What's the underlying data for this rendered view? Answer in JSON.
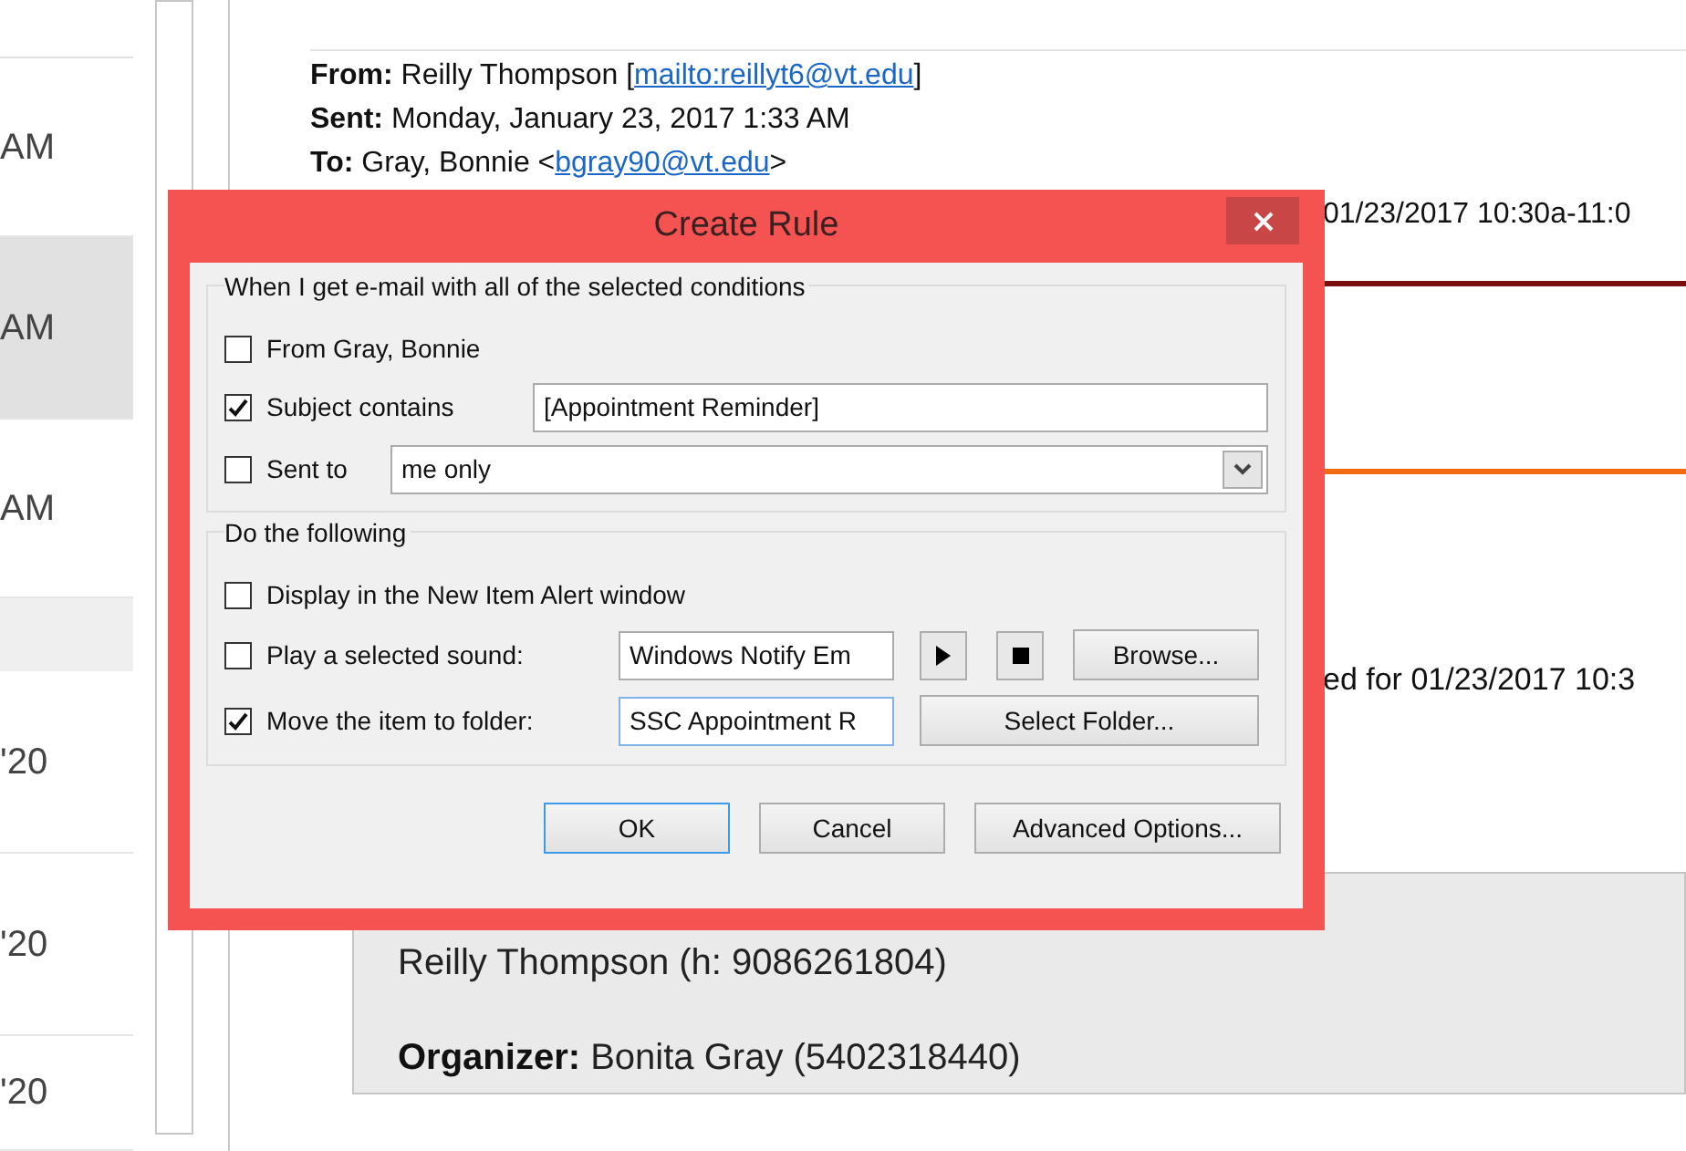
{
  "message_list": {
    "items": [
      {
        "kind": "message",
        "time": "AM",
        "selected": false
      },
      {
        "kind": "message",
        "time": "AM",
        "selected": true
      },
      {
        "kind": "message",
        "time": "AM",
        "selected": false
      },
      {
        "kind": "header"
      },
      {
        "kind": "message",
        "time": "'20",
        "selected": false
      },
      {
        "kind": "message",
        "time": "'20",
        "selected": false
      },
      {
        "kind": "message",
        "time": "'20",
        "selected": false
      }
    ]
  },
  "reading_pane": {
    "headers": [
      {
        "label": "From:",
        "text": "Reilly Thompson [",
        "link": "mailto:reillyt6@vt.edu",
        "suffix": "]"
      },
      {
        "label": "Sent:",
        "text": "Monday, January 23, 2017 1:33 AM"
      },
      {
        "label": "To:",
        "text": "Gray, Bonnie <",
        "link": "bgray90@vt.edu",
        "suffix": ">"
      }
    ],
    "meeting_time": "01/23/2017 10:30a-11:0",
    "scheduled_text": "ed for 01/23/2017 10:3",
    "details": [
      {
        "text": "Reilly Thompson (h: 9086261804)"
      },
      {
        "label": "Organizer:",
        "text": "Bonita Gray (5402318440)"
      }
    ]
  },
  "dialog": {
    "title": "Create Rule",
    "groups": [
      {
        "title": "When I get e-mail with all of the selected conditions",
        "rows": [
          {
            "kind": "checkbox",
            "label": "From Gray, Bonnie",
            "checked": false
          },
          {
            "kind": "text",
            "label": "Subject contains",
            "checked": true,
            "value": "[Appointment Reminder]"
          },
          {
            "kind": "dropdown",
            "label": "Sent to",
            "checked": false,
            "value": "me only"
          }
        ]
      },
      {
        "title": "Do the following",
        "rows": [
          {
            "kind": "checkbox",
            "label": "Display in the New Item Alert window",
            "checked": false
          },
          {
            "kind": "sound",
            "label": "Play a selected sound:",
            "checked": false,
            "value": "Windows Notify Em",
            "button": "Browse..."
          },
          {
            "kind": "folder",
            "label": "Move the item to folder:",
            "checked": true,
            "value": "SSC Appointment R",
            "button": "Select Folder..."
          }
        ]
      }
    ],
    "buttons": [
      {
        "label": "OK",
        "default": true
      },
      {
        "label": "Cancel",
        "default": false
      },
      {
        "label": "Advanced Options...",
        "default": false
      }
    ]
  }
}
